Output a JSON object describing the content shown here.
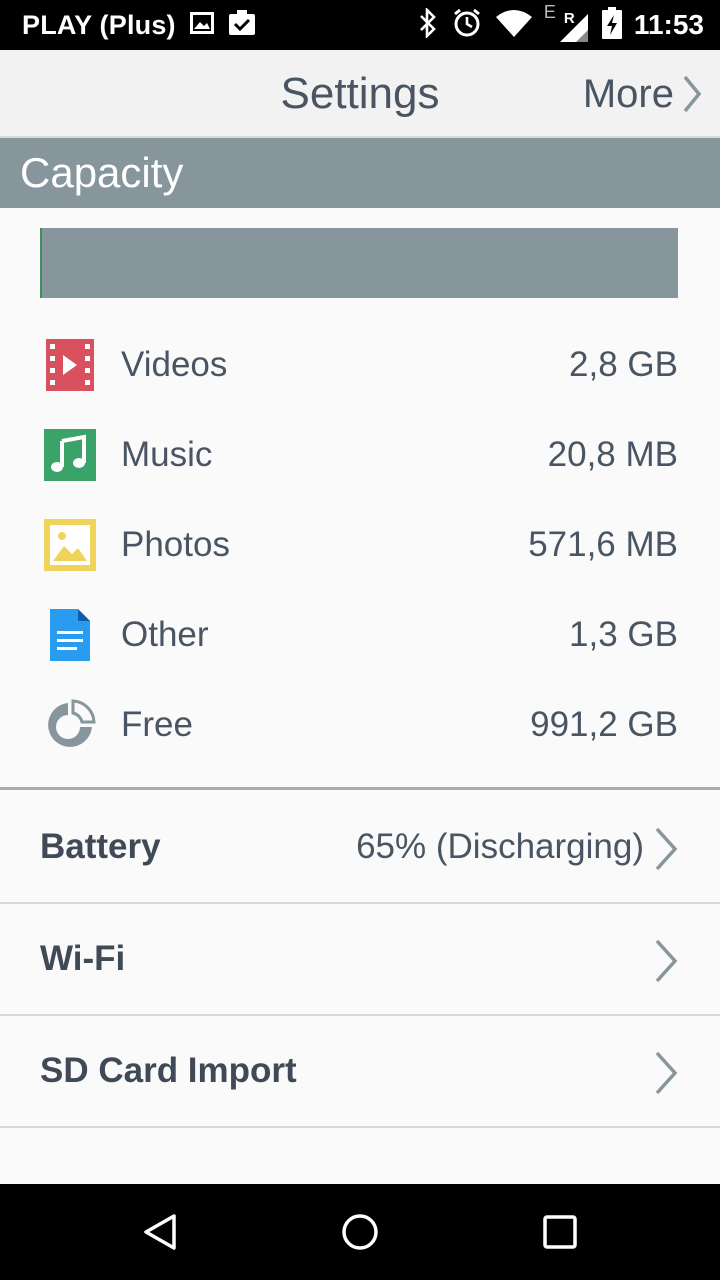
{
  "status_bar": {
    "carrier": "PLAY (Plus)",
    "network_letter": "E",
    "roaming_letter": "R",
    "time": "11:53",
    "icons": [
      "image-icon",
      "clipboard-check-icon",
      "bluetooth-icon",
      "alarm-icon",
      "wifi-icon",
      "signal-icon",
      "battery-charging-icon"
    ]
  },
  "app_bar": {
    "title": "Settings",
    "more_label": "More"
  },
  "capacity": {
    "header": "Capacity",
    "items": [
      {
        "label": "Videos",
        "value": "2,8 GB",
        "icon": "video-icon",
        "color": "#d9505e"
      },
      {
        "label": "Music",
        "value": "20,8 MB",
        "icon": "music-icon",
        "color": "#3aa36a"
      },
      {
        "label": "Photos",
        "value": "571,6 MB",
        "icon": "photo-icon",
        "color": "#f0d35a"
      },
      {
        "label": "Other",
        "value": "1,3 GB",
        "icon": "document-icon",
        "color": "#2a9cf0"
      },
      {
        "label": "Free",
        "value": "991,2 GB",
        "icon": "pie-chart-icon",
        "color": "#87959c"
      }
    ]
  },
  "settings": {
    "battery": {
      "label": "Battery",
      "value": "65% (Discharging)"
    },
    "wifi": {
      "label": "Wi-Fi"
    },
    "sd_import": {
      "label": "SD Card Import"
    }
  },
  "nav_bar": {
    "icons": [
      "back-icon",
      "home-icon",
      "recents-icon"
    ]
  },
  "colors": {
    "section_header": "#87959c",
    "text": "#4a5563",
    "background": "#fafafa"
  }
}
